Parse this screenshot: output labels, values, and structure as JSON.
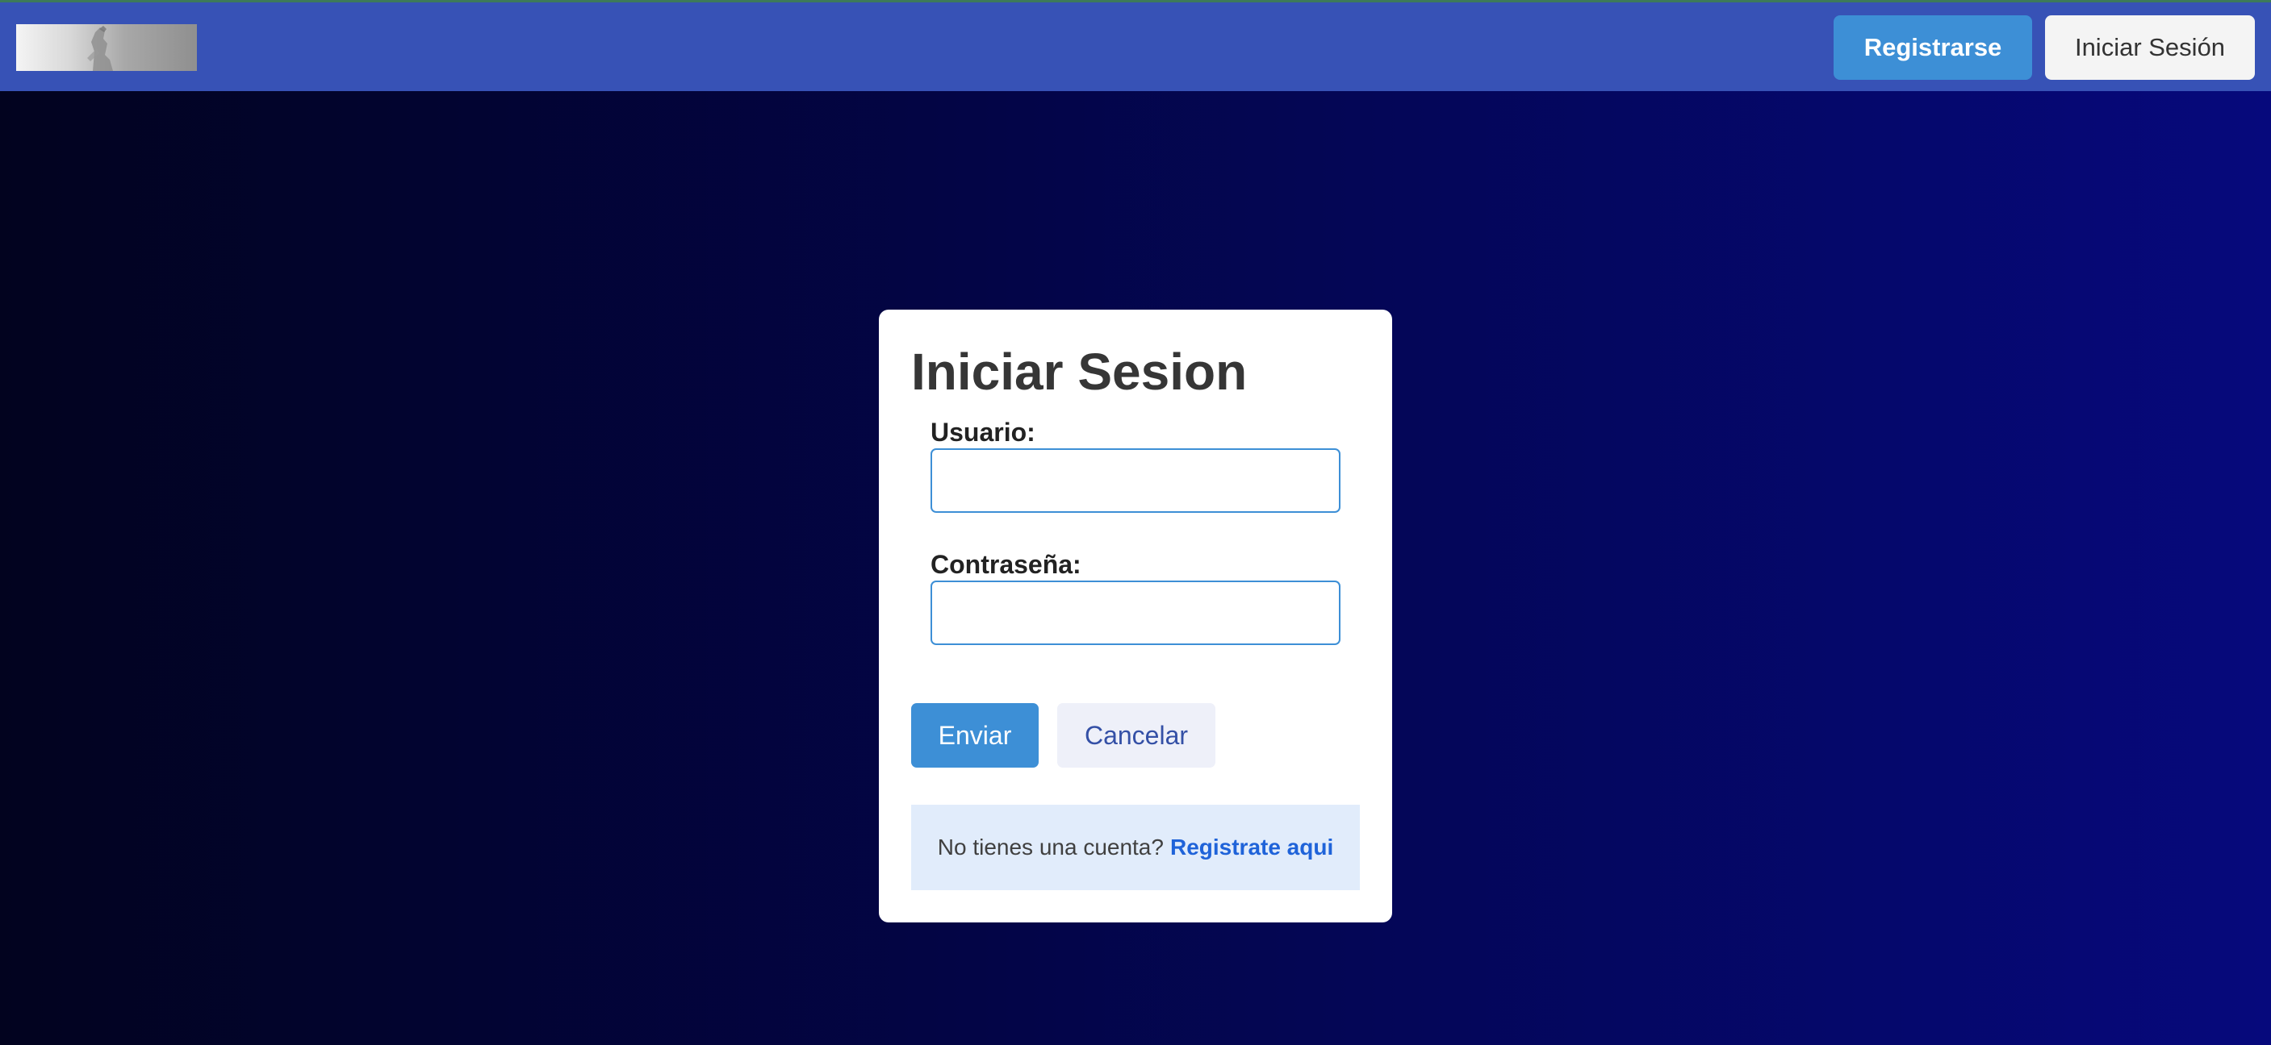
{
  "header": {
    "logo_icon": "statue-logo-image",
    "register_label": "Registrarse",
    "login_label": "Iniciar Sesión"
  },
  "login_form": {
    "title": "Iniciar Sesion",
    "username_label": "Usuario:",
    "username_value": "",
    "password_label": "Contraseña:",
    "password_value": "",
    "submit_label": "Enviar",
    "cancel_label": "Cancelar",
    "no_account_text": "No tienes una cuenta?",
    "register_link_text": "Registrate aqui"
  },
  "colors": {
    "navbar": "#3752b6",
    "primary_button": "#3d8fd6",
    "background_left": "#02031f",
    "background_right": "#06097c",
    "notice_background": "#e1ecfb",
    "link": "#1f63d9"
  }
}
